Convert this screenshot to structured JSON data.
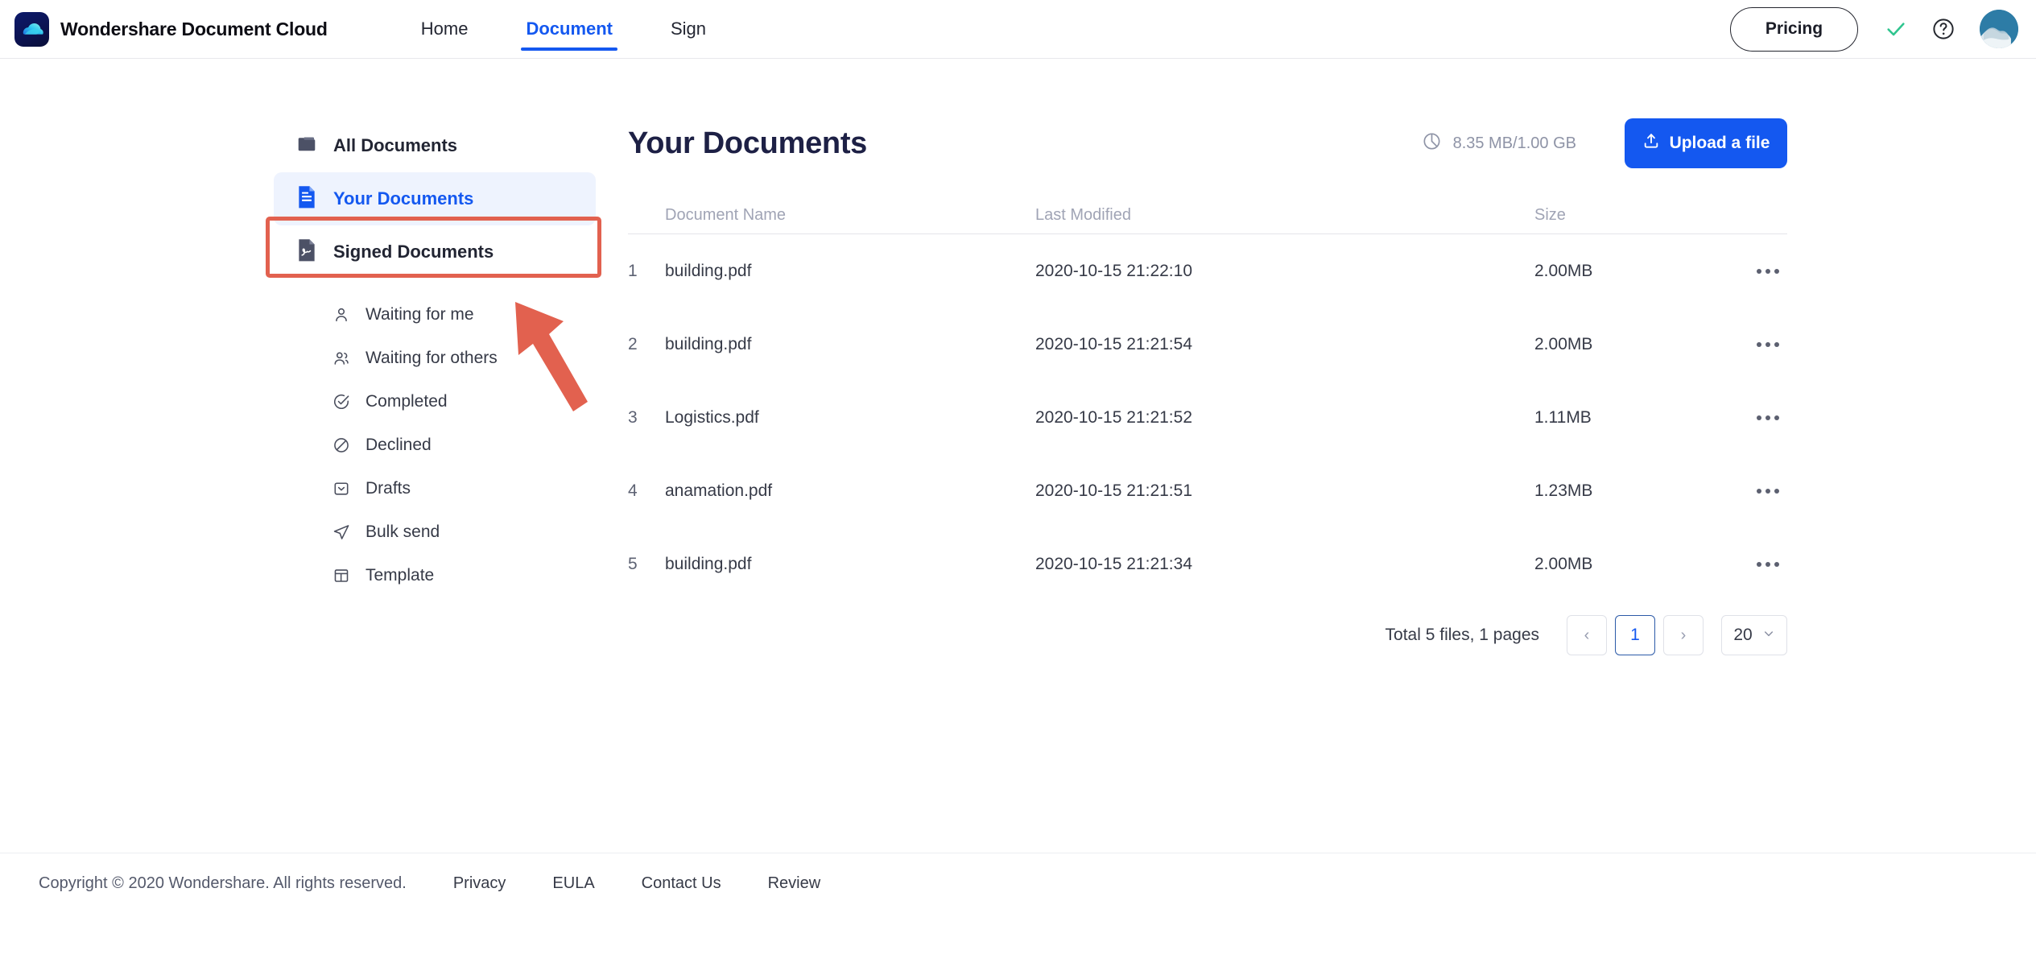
{
  "header": {
    "brand_name": "Wondershare Document Cloud",
    "logo_icon": "cloud-logo-icon",
    "nav": [
      {
        "label": "Home",
        "active": false
      },
      {
        "label": "Document",
        "active": true
      },
      {
        "label": "Sign",
        "active": false
      }
    ],
    "pricing_label": "Pricing",
    "check_icon": "check-icon",
    "help_icon": "question-mark-icon",
    "avatar_icon": "user-avatar",
    "accent_color": "#1458f0",
    "check_color": "#2fc58f"
  },
  "sidebar": {
    "main_items": [
      {
        "label": "All Documents",
        "icon": "folder-icon",
        "selected": false
      },
      {
        "label": "Your Documents",
        "icon": "document-icon",
        "selected": true
      },
      {
        "label": "Signed Documents",
        "icon": "signed-document-icon",
        "selected": false
      }
    ],
    "sub_items": [
      {
        "label": "Waiting for me",
        "icon": "person-icon"
      },
      {
        "label": "Waiting for others",
        "icon": "people-icon"
      },
      {
        "label": "Completed",
        "icon": "check-circle-icon"
      },
      {
        "label": "Declined",
        "icon": "ban-circle-icon"
      },
      {
        "label": "Drafts",
        "icon": "inbox-icon"
      },
      {
        "label": "Bulk send",
        "icon": "paper-plane-icon"
      },
      {
        "label": "Template",
        "icon": "layout-grid-icon"
      }
    ],
    "selected_bg": "#eef3fe",
    "selected_text_color": "#1458f0"
  },
  "annotation": {
    "highlight_color": "#e2614f",
    "arrow_icon": "pointer-arrow",
    "target": "Your Documents"
  },
  "main": {
    "title": "Your Documents",
    "storage_icon": "pie-chart-icon",
    "storage_text": "8.35 MB/1.00 GB",
    "upload_icon": "upload-icon",
    "upload_label": "Upload a file",
    "table": {
      "columns": [
        "Document Name",
        "Last Modified",
        "Size"
      ],
      "rows": [
        {
          "index": "1",
          "name": "building.pdf",
          "modified": "2020-10-15 21:22:10",
          "size": "2.00MB",
          "menu_icon": "more-horizontal-icon"
        },
        {
          "index": "2",
          "name": "building.pdf",
          "modified": "2020-10-15 21:21:54",
          "size": "2.00MB",
          "menu_icon": "more-horizontal-icon"
        },
        {
          "index": "3",
          "name": "Logistics.pdf",
          "modified": "2020-10-15 21:21:52",
          "size": "1.11MB",
          "menu_icon": "more-horizontal-icon"
        },
        {
          "index": "4",
          "name": "anamation.pdf",
          "modified": "2020-10-15 21:21:51",
          "size": "1.23MB",
          "menu_icon": "more-horizontal-icon"
        },
        {
          "index": "5",
          "name": "building.pdf",
          "modified": "2020-10-15 21:21:34",
          "size": "2.00MB",
          "menu_icon": "more-horizontal-icon"
        }
      ]
    },
    "pagination": {
      "total_text": "Total 5 files, 1 pages",
      "prev_label": "‹",
      "current_page": "1",
      "next_label": "›",
      "page_size": "20",
      "chevron_icon": "chevron-down-icon"
    }
  },
  "footer": {
    "copyright": "Copyright © 2020 Wondershare. All rights reserved.",
    "links": [
      "Privacy",
      "EULA",
      "Contact Us",
      "Review"
    ]
  }
}
